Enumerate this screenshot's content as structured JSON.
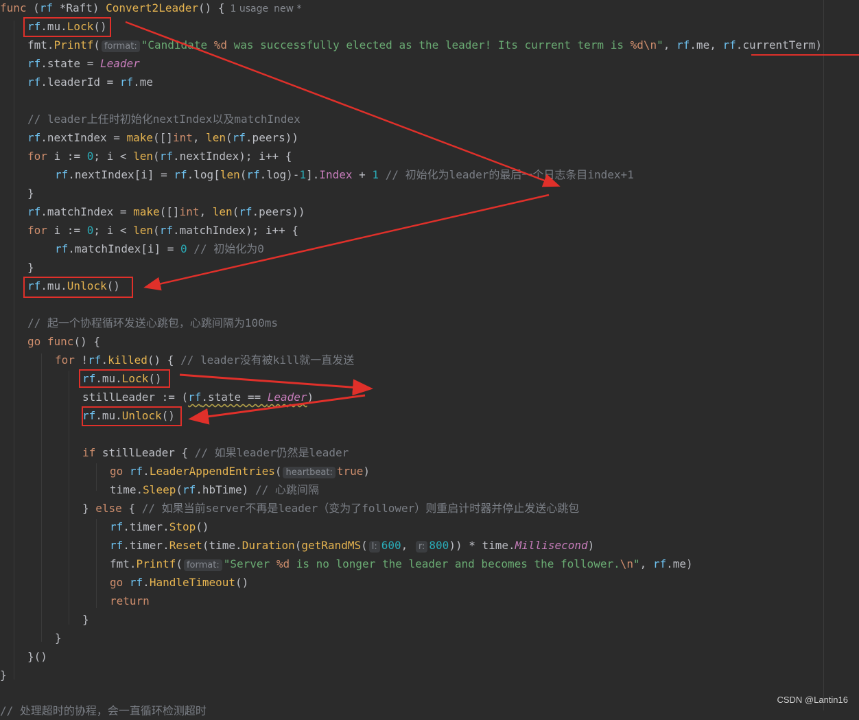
{
  "code": {
    "l1": {
      "kw": "func",
      "p1": " (",
      "recv": "rf",
      "p2": " *Raft) ",
      "name": "Convert2Leader",
      "p3": "() {",
      "usage": "1 usage",
      "status": "new *"
    },
    "l2": {
      "a": "rf",
      "b": ".mu.",
      "c": "Lock",
      "d": "()"
    },
    "l3": {
      "a": "fmt",
      "b": ".",
      "c": "Printf",
      "d": "(",
      "hint": "format:",
      "str1": "\"Candidate ",
      "fmt1": "%d",
      "str2": " was successfully elected as the leader! Its current term is ",
      "fmt2": "%d",
      "esc": "\\n",
      "str3": "\"",
      "e": ", ",
      "f": "rf",
      "g": ".me, ",
      "h": "rf",
      "i": ".currentTerm)"
    },
    "l4": {
      "a": "rf",
      "b": ".state = ",
      "c": "Leader"
    },
    "l5": {
      "a": "rf",
      "b": ".leaderId = ",
      "c": "rf",
      "d": ".me"
    },
    "l7": {
      "text": "// leader上任时初始化nextIndex以及matchIndex"
    },
    "l8": {
      "a": "rf",
      "b": ".nextIndex = ",
      "c": "make",
      "d": "([]",
      "e": "int",
      "f": ", ",
      "g": "len",
      "h": "(",
      "i": "rf",
      "j": ".peers))"
    },
    "l9": {
      "a": "for",
      "b": " i := ",
      "c": "0",
      "d": "; i < ",
      "e": "len",
      "f": "(",
      "g": "rf",
      "h": ".nextIndex); i++ {"
    },
    "l10": {
      "a": "rf",
      "b": ".nextIndex[i] = ",
      "c": "rf",
      "d": ".log[",
      "e": "len",
      "f": "(",
      "g": "rf",
      "h": ".log)-",
      "i": "1",
      "j": "].",
      "k": "Index",
      "l": " + ",
      "m": "1",
      "n": " // 初始化为leader的最后一个日志条目index+1"
    },
    "l11": {
      "a": "}"
    },
    "l12": {
      "a": "rf",
      "b": ".matchIndex = ",
      "c": "make",
      "d": "([]",
      "e": "int",
      "f": ", ",
      "g": "len",
      "h": "(",
      "i": "rf",
      "j": ".peers))"
    },
    "l13": {
      "a": "for",
      "b": " i := ",
      "c": "0",
      "d": "; i < ",
      "e": "len",
      "f": "(",
      "g": "rf",
      "h": ".matchIndex); i++ {"
    },
    "l14": {
      "a": "rf",
      "b": ".matchIndex[i] = ",
      "c": "0",
      "d": " // 初始化为0"
    },
    "l15": {
      "a": "}"
    },
    "l16": {
      "a": "rf",
      "b": ".mu.",
      "c": "Unlock",
      "d": "()"
    },
    "l18": {
      "text": "// 起一个协程循环发送心跳包，心跳间隔为100ms"
    },
    "l19": {
      "a": "go",
      "b": " ",
      "c": "func",
      "d": "() {"
    },
    "l20": {
      "a": "for",
      "b": " !",
      "c": "rf",
      "d": ".",
      "e": "killed",
      "f": "() { ",
      "g": "// leader没有被kill就一直发送"
    },
    "l21": {
      "a": "rf",
      "b": ".mu.",
      "c": "Lock",
      "d": "()"
    },
    "l22": {
      "a": "stillLeader := (",
      "b": "rf",
      "c": ".state == ",
      "d": "Leader",
      "e": ")"
    },
    "l23": {
      "a": "rf",
      "b": ".mu.",
      "c": "Unlock",
      "d": "()"
    },
    "l25": {
      "a": "if",
      "b": " stillLeader { ",
      "c": "// 如果leader仍然是leader"
    },
    "l26": {
      "a": "go",
      "b": " ",
      "c": "rf",
      "d": ".",
      "e": "LeaderAppendEntries",
      "f": "(",
      "hint": "heartbeat:",
      "g": "true",
      "h": ")"
    },
    "l27": {
      "a": "time",
      "b": ".",
      "c": "Sleep",
      "d": "(",
      "e": "rf",
      "f": ".hbTime) ",
      "g": "// 心跳间隔"
    },
    "l28": {
      "a": "} ",
      "b": "else",
      "c": " { ",
      "d": "// 如果当前server不再是leader（变为了follower）则重启计时器并停止发送心跳包"
    },
    "l29": {
      "a": "rf",
      "b": ".timer.",
      "c": "Stop",
      "d": "()"
    },
    "l30": {
      "a": "rf",
      "b": ".timer.",
      "c": "Reset",
      "d": "(",
      "e": "time",
      "f": ".",
      "g": "Duration",
      "h": "(",
      "i": "getRandMS",
      "j": "(",
      "hint1": "l:",
      "k": "600",
      "l": ", ",
      "hint2": "r:",
      "m": "800",
      "n": ")) * ",
      "o": "time",
      "p": ".",
      "q": "Millisecond",
      "r": ")"
    },
    "l31": {
      "a": "fmt",
      "b": ".",
      "c": "Printf",
      "d": "(",
      "hint": "format:",
      "s1": "\"Server ",
      "f1": "%d",
      "s2": " is no longer the leader and becomes the follower.",
      "esc": "\\n",
      "s3": "\"",
      "e": ", ",
      "f": "rf",
      "g": ".me)"
    },
    "l32": {
      "a": "go",
      "b": " ",
      "c": "rf",
      "d": ".",
      "e": "HandleTimeout",
      "f": "()"
    },
    "l33": {
      "a": "return"
    },
    "l34": {
      "a": "}"
    },
    "l35": {
      "a": "}"
    },
    "l36": {
      "a": "}()"
    },
    "l37": {
      "a": "}"
    },
    "l38": {
      "text": "// 处理超时的协程，会一直循环检测超时"
    }
  },
  "watermark": "CSDN @Lantin16",
  "colors": {
    "annotation": "#e0302a",
    "background": "#2b2b2b"
  }
}
